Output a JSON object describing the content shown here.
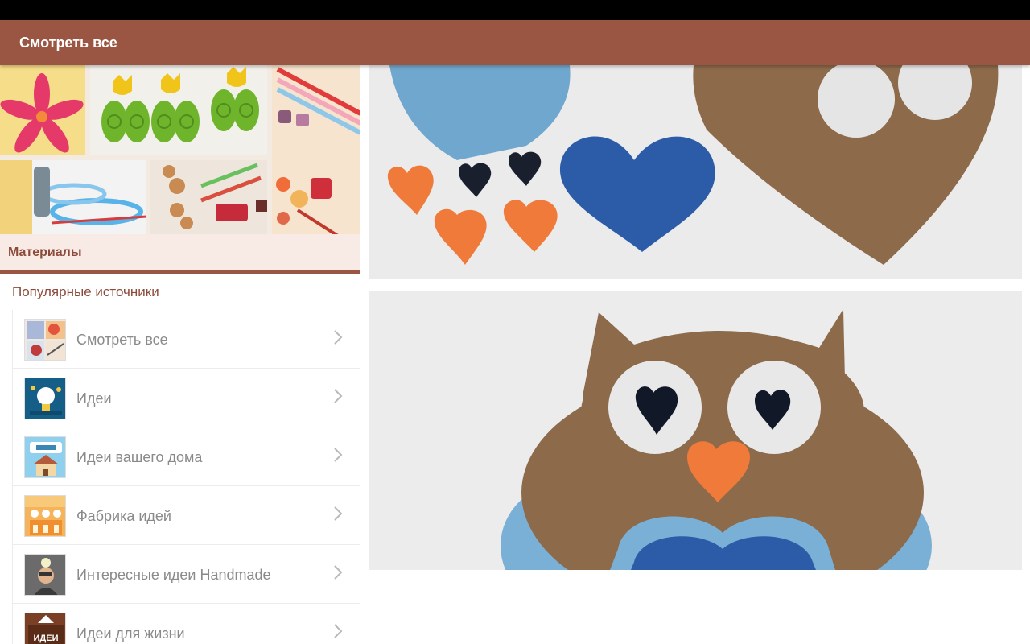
{
  "app_bar": {
    "title": "Смотреть все"
  },
  "left_panel": {
    "category_label": "Материалы",
    "section_title": "Популярные источники",
    "sources": [
      {
        "label": "Смотреть все",
        "thumb_icon": "collage-thumb-icon"
      },
      {
        "label": "Идеи",
        "thumb_icon": "lightbulb-thumb-icon"
      },
      {
        "label": "Идеи вашего дома",
        "thumb_icon": "house-thumb-icon"
      },
      {
        "label": "Фабрика идей",
        "thumb_icon": "factory-thumb-icon"
      },
      {
        "label": "Интересные идеи Handmade",
        "thumb_icon": "person-thumb-icon"
      },
      {
        "label": "Идеи для жизни",
        "thumb_icon": "sign-thumb-icon",
        "thumb_text": "ИДЕИ"
      }
    ]
  },
  "colors": {
    "accent": "#9a5643",
    "category_bg": "#f8ebe6",
    "section_text": "#8b4a3a"
  }
}
